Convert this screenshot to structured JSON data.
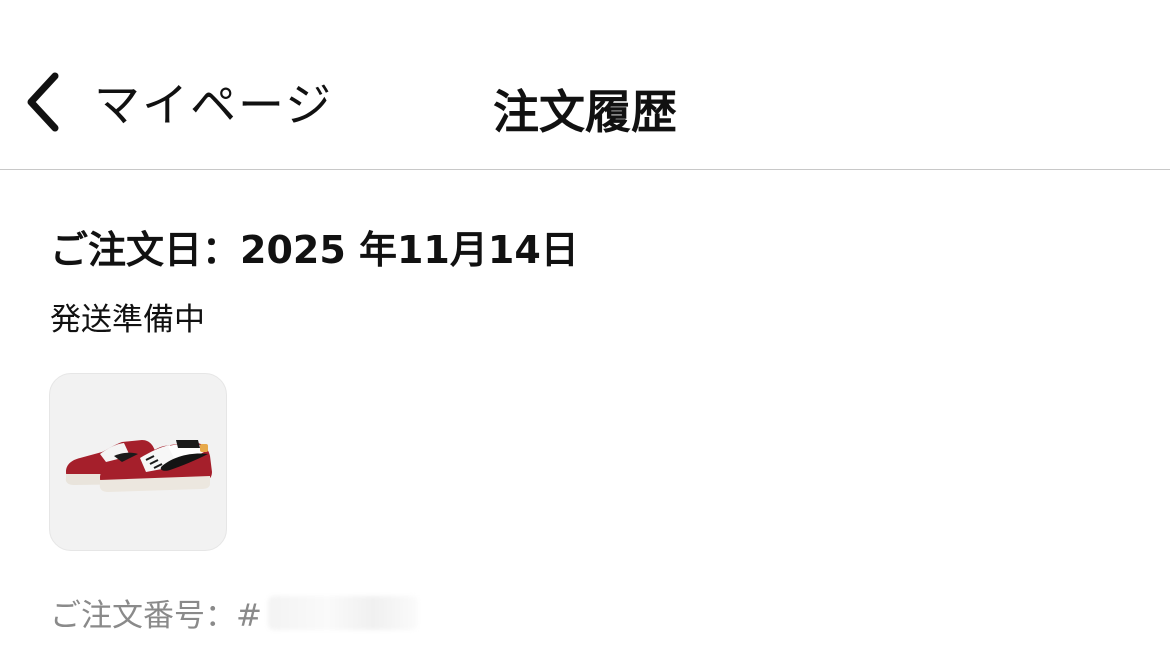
{
  "header": {
    "back_label": "マイページ",
    "title": "注文履歴"
  },
  "order": {
    "date_text": "ご注文日：2025 年11月14日",
    "status": "発送準備中",
    "product_image_icon": "sneaker-image",
    "order_number_label": "ご注文番号：#",
    "order_number_value": ""
  },
  "colors": {
    "background": "#ffffff",
    "text_primary": "#111111",
    "text_secondary": "#8a8a8a",
    "divider": "#c8c8c8",
    "thumb_bg": "#f2f2f2"
  }
}
